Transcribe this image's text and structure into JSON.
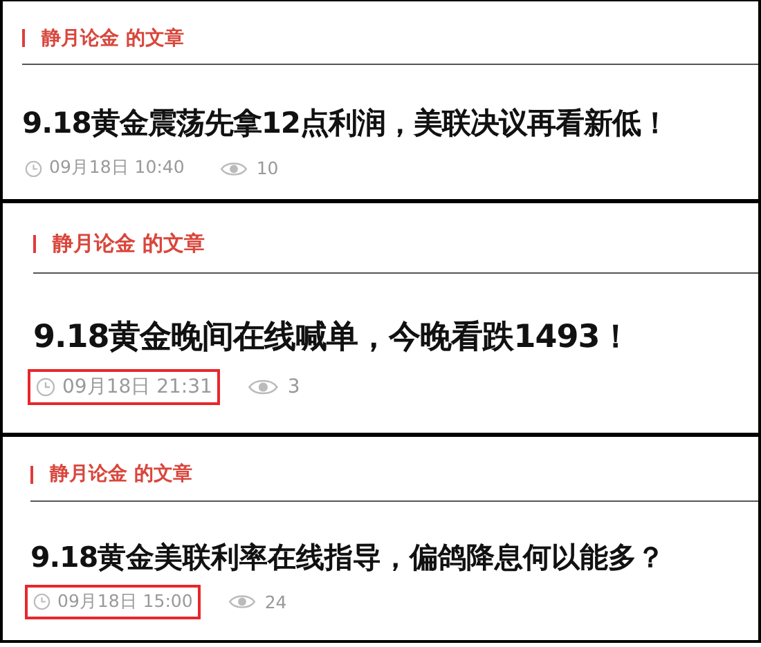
{
  "panels": [
    {
      "heading": "静月论金 的文章",
      "title": "9.18黄金震荡先拿12点利润，美联决议再看新低！",
      "date": "09月18日 10:40",
      "views": "10",
      "highlighted": false
    },
    {
      "heading": "静月论金 的文章",
      "title": "9.18黄金晚间在线喊单，今晚看跌1493！",
      "date": "09月18日 21:31",
      "views": "3",
      "highlighted": true
    },
    {
      "heading": "静月论金 的文章",
      "title": "9.18黄金美联利率在线指导，偏鸽降息何以能多？",
      "date": "09月18日 15:00",
      "views": "24",
      "highlighted": true
    }
  ]
}
